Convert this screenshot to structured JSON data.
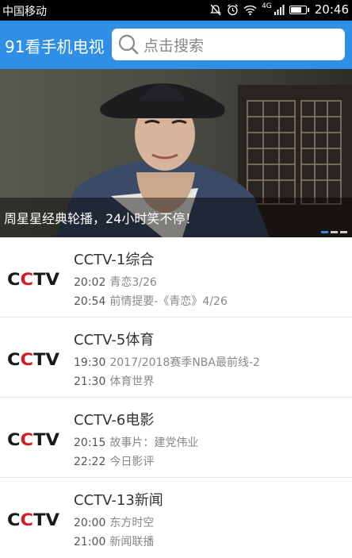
{
  "status_bar": {
    "carrier": "中国移动",
    "network": "4G",
    "battery_level": 0.75,
    "time": "20:46"
  },
  "header": {
    "app_title": "91看手机电视",
    "search_placeholder": "点击搜索"
  },
  "banner": {
    "caption": "周星星经典轮播，24小时笑不停！",
    "page_count": 3,
    "active_page": 1
  },
  "channels": [
    {
      "logo_text": "CCTV",
      "name": "CCTV-1综合",
      "programs": [
        {
          "time": "20:02",
          "title": "青恋3/26"
        },
        {
          "time": "20:54",
          "title": "前情提要-《青恋》4/26"
        }
      ]
    },
    {
      "logo_text": "CCTV",
      "name": "CCTV-5体育",
      "programs": [
        {
          "time": "19:30",
          "title": "2017/2018赛季NBA最前线-2"
        },
        {
          "time": "21:30",
          "title": "体育世界"
        }
      ]
    },
    {
      "logo_text": "CCTV",
      "name": "CCTV-6电影",
      "programs": [
        {
          "time": "20:15",
          "title": "故事片：建党伟业"
        },
        {
          "time": "22:22",
          "title": "今日影评"
        }
      ]
    },
    {
      "logo_text": "CCTV",
      "name": "CCTV-13新闻",
      "programs": [
        {
          "time": "20:00",
          "title": "东方时空"
        },
        {
          "time": "21:00",
          "title": "新闻联播"
        }
      ]
    }
  ],
  "colors": {
    "header": "#2f8ee6",
    "logo_red": "#d11f25",
    "logo_black": "#1a1a1a"
  }
}
